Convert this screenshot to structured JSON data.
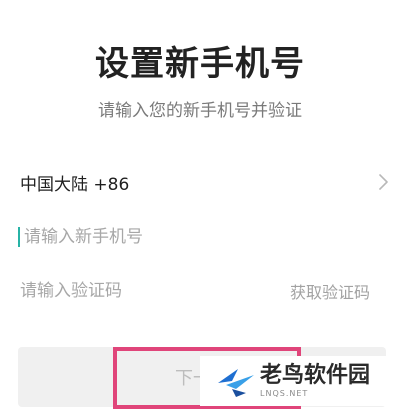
{
  "title": "设置新手机号",
  "subtitle": "请输入您的新手机号并验证",
  "region": {
    "label": "中国大陆 +86",
    "chevron_icon": "chevron-right-icon"
  },
  "phone": {
    "placeholder": "请输入新手机号",
    "value": ""
  },
  "code": {
    "placeholder": "请输入验证码",
    "value": "",
    "get_code_label": "获取验证码"
  },
  "next_button": {
    "label": "下一步"
  },
  "colors": {
    "cursor": "#27b3a6",
    "highlight": "#e0457a",
    "button_bg": "#f0f0f0"
  },
  "watermark": {
    "title": "老鸟软件园",
    "sub": "LNQS.NET",
    "logo_icon": "bird-logo-icon"
  }
}
